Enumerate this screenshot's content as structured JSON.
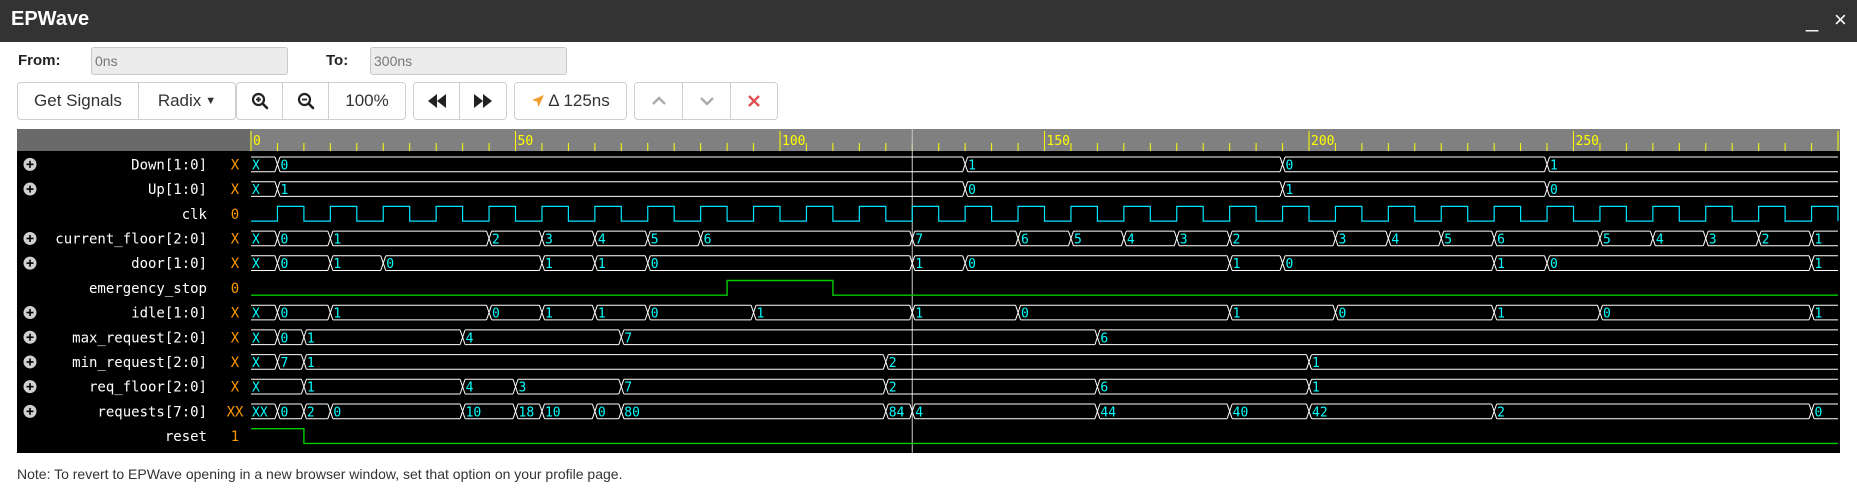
{
  "app": {
    "title": "EPWave",
    "minimize_glyph": "_",
    "close_glyph": "×"
  },
  "range": {
    "from_label": "From:",
    "from_value": "0ns",
    "to_label": "To:",
    "to_value": "300ns"
  },
  "toolbar": {
    "get_signals": "Get Signals",
    "radix": "Radix",
    "zoom": "100%",
    "delta": "Δ 125ns"
  },
  "timeline": {
    "ticks": [
      "0",
      "50",
      "100",
      "150",
      "200",
      "250"
    ],
    "tick_values": [
      0,
      50,
      100,
      150,
      200,
      250
    ],
    "cursor_time": 125
  },
  "signals": [
    {
      "name": "Down[1:0]",
      "value": "X",
      "expandable": true,
      "type": "bus",
      "segments": [
        [
          0,
          "X"
        ],
        [
          5,
          "0"
        ],
        [
          135,
          "1"
        ],
        [
          195,
          "0"
        ],
        [
          245,
          "1"
        ]
      ]
    },
    {
      "name": "Up[1:0]",
      "value": "X",
      "expandable": true,
      "type": "bus",
      "segments": [
        [
          0,
          "X"
        ],
        [
          5,
          "1"
        ],
        [
          135,
          "0"
        ],
        [
          195,
          "1"
        ],
        [
          245,
          "0"
        ]
      ]
    },
    {
      "name": "clk",
      "value": "0",
      "expandable": false,
      "type": "clock",
      "half_period": 5
    },
    {
      "name": "current_floor[2:0]",
      "value": "X",
      "expandable": true,
      "type": "bus",
      "segments": [
        [
          0,
          "X"
        ],
        [
          5,
          "0"
        ],
        [
          15,
          "1"
        ],
        [
          45,
          "2"
        ],
        [
          55,
          "3"
        ],
        [
          65,
          "4"
        ],
        [
          75,
          "5"
        ],
        [
          85,
          "6"
        ],
        [
          125,
          "7"
        ],
        [
          145,
          "6"
        ],
        [
          155,
          "5"
        ],
        [
          165,
          "4"
        ],
        [
          175,
          "3"
        ],
        [
          185,
          "2"
        ],
        [
          205,
          "3"
        ],
        [
          215,
          "4"
        ],
        [
          225,
          "5"
        ],
        [
          235,
          "6"
        ],
        [
          255,
          "5"
        ],
        [
          265,
          "4"
        ],
        [
          275,
          "3"
        ],
        [
          285,
          "2"
        ],
        [
          295,
          "1"
        ]
      ]
    },
    {
      "name": "door[1:0]",
      "value": "X",
      "expandable": true,
      "type": "bus",
      "segments": [
        [
          0,
          "X"
        ],
        [
          5,
          "0"
        ],
        [
          15,
          "1"
        ],
        [
          25,
          "0"
        ],
        [
          55,
          "1"
        ],
        [
          65,
          "1"
        ],
        [
          75,
          "0"
        ],
        [
          125,
          "1"
        ],
        [
          135,
          "0"
        ],
        [
          185,
          "1"
        ],
        [
          195,
          "0"
        ],
        [
          235,
          "1"
        ],
        [
          245,
          "0"
        ],
        [
          295,
          "1"
        ]
      ]
    },
    {
      "name": "emergency_stop",
      "value": "0",
      "expandable": false,
      "type": "bit",
      "transitions": [
        [
          0,
          0
        ],
        [
          90,
          1
        ],
        [
          110,
          0
        ]
      ]
    },
    {
      "name": "idle[1:0]",
      "value": "X",
      "expandable": true,
      "type": "bus",
      "segments": [
        [
          0,
          "X"
        ],
        [
          5,
          "0"
        ],
        [
          15,
          "1"
        ],
        [
          45,
          "0"
        ],
        [
          55,
          "1"
        ],
        [
          65,
          "1"
        ],
        [
          75,
          "0"
        ],
        [
          95,
          "1"
        ],
        [
          125,
          "1"
        ],
        [
          145,
          "0"
        ],
        [
          185,
          "1"
        ],
        [
          205,
          "0"
        ],
        [
          235,
          "1"
        ],
        [
          255,
          "0"
        ],
        [
          295,
          "1"
        ]
      ]
    },
    {
      "name": "max_request[2:0]",
      "value": "X",
      "expandable": true,
      "type": "bus",
      "segments": [
        [
          0,
          "X"
        ],
        [
          5,
          "0"
        ],
        [
          10,
          "1"
        ],
        [
          40,
          "4"
        ],
        [
          70,
          "7"
        ],
        [
          160,
          "6"
        ]
      ]
    },
    {
      "name": "min_request[2:0]",
      "value": "X",
      "expandable": true,
      "type": "bus",
      "segments": [
        [
          0,
          "X"
        ],
        [
          5,
          "7"
        ],
        [
          10,
          "1"
        ],
        [
          120,
          "2"
        ],
        [
          200,
          "1"
        ]
      ]
    },
    {
      "name": "req_floor[2:0]",
      "value": "X",
      "expandable": true,
      "type": "bus",
      "segments": [
        [
          0,
          "X"
        ],
        [
          10,
          "1"
        ],
        [
          40,
          "4"
        ],
        [
          50,
          "3"
        ],
        [
          70,
          "7"
        ],
        [
          120,
          "2"
        ],
        [
          160,
          "6"
        ],
        [
          200,
          "1"
        ]
      ]
    },
    {
      "name": "requests[7:0]",
      "value": "XX",
      "expandable": true,
      "type": "bus",
      "segments": [
        [
          0,
          "XX"
        ],
        [
          5,
          "0"
        ],
        [
          10,
          "2"
        ],
        [
          15,
          "0"
        ],
        [
          40,
          "10"
        ],
        [
          50,
          "18"
        ],
        [
          55,
          "10"
        ],
        [
          65,
          "0"
        ],
        [
          70,
          "80"
        ],
        [
          120,
          "84"
        ],
        [
          125,
          "4"
        ],
        [
          160,
          "44"
        ],
        [
          185,
          "40"
        ],
        [
          200,
          "42"
        ],
        [
          235,
          "2"
        ],
        [
          295,
          "0"
        ]
      ]
    },
    {
      "name": "reset",
      "value": "1",
      "expandable": false,
      "type": "bit",
      "transitions": [
        [
          0,
          1
        ],
        [
          10,
          0
        ]
      ]
    }
  ],
  "note": "Note: To revert to EPWave opening in a new browser window, set that option on your profile page.",
  "colors": {
    "value_x": "#ff9900",
    "wave_bus": "#ffffff",
    "wave_text": "#00ffff",
    "wave_bit": "#00cc00",
    "clock": "#00e5ff",
    "ruler": "#808080",
    "ruler_tick": "#ffff00",
    "delete": "#e05050"
  },
  "icons": [
    "zoom-in-icon",
    "zoom-out-icon",
    "rewind-icon",
    "fast-forward-icon",
    "cursor-arrow-icon",
    "chevron-up-icon",
    "chevron-down-icon",
    "close-icon",
    "expand-plus-icon"
  ]
}
